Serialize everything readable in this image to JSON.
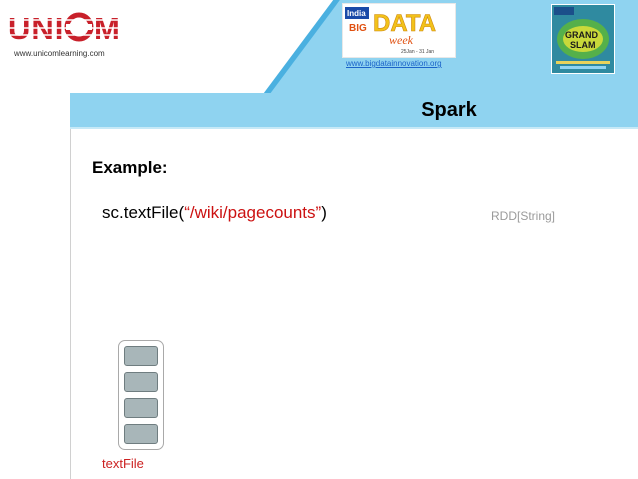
{
  "header": {
    "brand_logo_text": "UNICOM",
    "brand_url": "www.unicomlearning.com",
    "event_logo_text": "India BIG DATA week",
    "event_dates": "25Jan - 31 Jan",
    "event_url": "www.bigdatainnovation.org",
    "poster_text": "GRAND SLAM"
  },
  "slide": {
    "title": "Spark",
    "example_heading": "Example:",
    "code_prefix": "sc.textFile(",
    "code_string": "“/wiki/pagecounts”",
    "code_suffix": ")",
    "rdd_type": "RDD[String]",
    "rdd_label": "textFile",
    "partition_count": 4
  },
  "colors": {
    "header_blue": "#8fd3f0",
    "accent_red": "#cc1111",
    "partition_fill": "#a8b6b9"
  }
}
